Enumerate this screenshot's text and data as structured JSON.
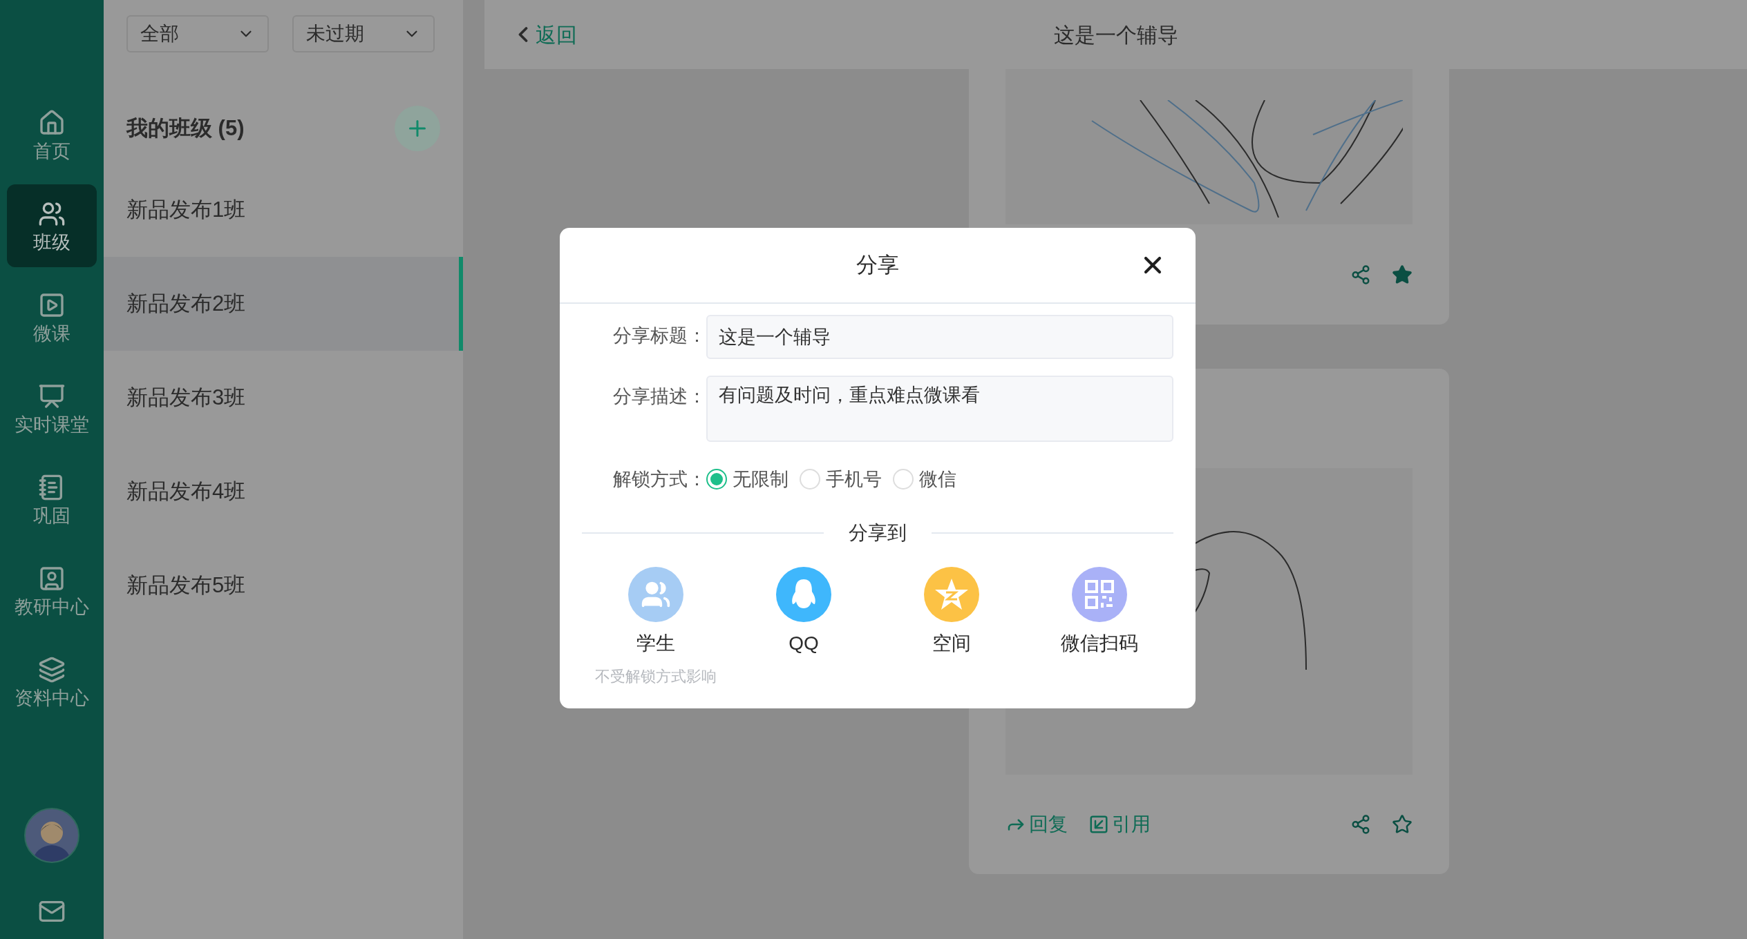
{
  "sidebar": {
    "items": [
      {
        "label": "首页",
        "kind": "home",
        "selected": false
      },
      {
        "label": "班级",
        "kind": "classes",
        "selected": true
      },
      {
        "label": "微课",
        "kind": "video",
        "selected": false
      },
      {
        "label": "实时课堂",
        "kind": "live",
        "selected": false
      },
      {
        "label": "巩固",
        "kind": "notes",
        "selected": false
      },
      {
        "label": "教研中心",
        "kind": "research",
        "selected": false
      },
      {
        "label": "资料中心",
        "kind": "library",
        "selected": false
      }
    ]
  },
  "class_list": {
    "filters": [
      {
        "value": "全部"
      },
      {
        "value": "未过期"
      }
    ],
    "heading": "我的班级 (5)",
    "classes": [
      {
        "name": "新品发布1班",
        "selected": false
      },
      {
        "name": "新品发布2班",
        "selected": true
      },
      {
        "name": "新品发布3班",
        "selected": false
      },
      {
        "name": "新品发布4班",
        "selected": false
      },
      {
        "name": "新品发布5班",
        "selected": false
      }
    ]
  },
  "topbar": {
    "back": "返回",
    "title": "这是一个辅导"
  },
  "cards": [
    {
      "starred": true
    },
    {
      "starred": false,
      "actions": [
        {
          "label": "回复",
          "kind": "reply"
        },
        {
          "label": "引用",
          "kind": "quote"
        }
      ]
    }
  ],
  "dialog": {
    "title": "分享",
    "fields": [
      {
        "label": "分享标题：",
        "value": "这是一个辅导",
        "kind": "input"
      },
      {
        "label": "分享描述：",
        "value": "有问题及时问，重点难点微课看",
        "kind": "textarea"
      }
    ],
    "unlock": {
      "label": "解锁方式：",
      "options": [
        {
          "label": "无限制",
          "selected": true
        },
        {
          "label": "手机号",
          "selected": false
        },
        {
          "label": "微信",
          "selected": false
        }
      ]
    },
    "share_to": "分享到",
    "targets": [
      {
        "label": "学生",
        "note": "不受解锁方式影响",
        "kind": "students"
      },
      {
        "label": "QQ",
        "kind": "qq"
      },
      {
        "label": "空间",
        "kind": "qzone"
      },
      {
        "label": "微信扫码",
        "kind": "qr"
      }
    ]
  }
}
